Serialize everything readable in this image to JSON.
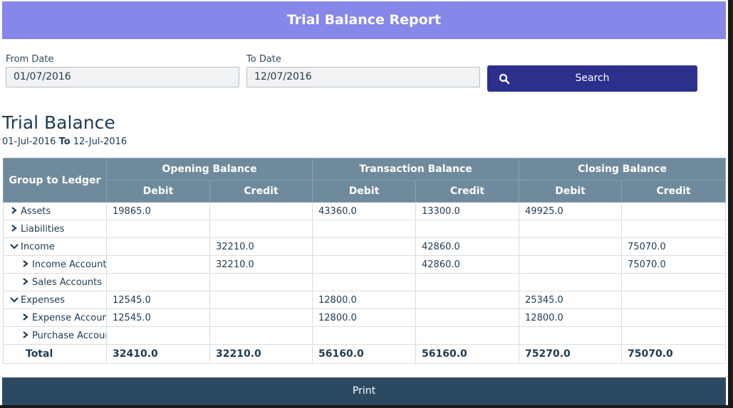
{
  "header": {
    "title": "Trial Balance Report"
  },
  "filters": {
    "from_label": "From Date",
    "from_value": "01/07/2016",
    "to_label": "To Date",
    "to_value": "12/07/2016",
    "search_label": "Search",
    "search_icon": "search-icon"
  },
  "report": {
    "title": "Trial Balance",
    "from": "01-Jul-2016",
    "to_word": "To",
    "to": "12-Jul-2016"
  },
  "table": {
    "group_header": "Group to Ledger",
    "col_groups": [
      "Opening Balance",
      "Transaction Balance",
      "Closing Balance"
    ],
    "sub_headers": [
      "Debit",
      "Credit",
      "Debit",
      "Credit",
      "Debit",
      "Credit"
    ],
    "rows": [
      {
        "label": "Assets",
        "level": 0,
        "expander": "chevron-right",
        "values": [
          "19865.0",
          "",
          "43360.0",
          "13300.0",
          "49925.0",
          ""
        ]
      },
      {
        "label": "Liabilities",
        "level": 0,
        "expander": "chevron-right",
        "values": [
          "",
          "",
          "",
          "",
          "",
          ""
        ]
      },
      {
        "label": "Income",
        "level": 0,
        "expander": "chevron-down",
        "values": [
          "",
          "32210.0",
          "",
          "42860.0",
          "",
          "75070.0"
        ]
      },
      {
        "label": "Income Account",
        "level": 1,
        "expander": "chevron-right",
        "values": [
          "",
          "32210.0",
          "",
          "42860.0",
          "",
          "75070.0"
        ]
      },
      {
        "label": "Sales Accounts",
        "level": 1,
        "expander": "chevron-right",
        "values": [
          "",
          "",
          "",
          "",
          "",
          ""
        ]
      },
      {
        "label": "Expenses",
        "level": 0,
        "expander": "chevron-down",
        "values": [
          "12545.0",
          "",
          "12800.0",
          "",
          "25345.0",
          ""
        ]
      },
      {
        "label": "Expense Account",
        "level": 1,
        "expander": "chevron-right",
        "values": [
          "12545.0",
          "",
          "12800.0",
          "",
          "12800.0",
          ""
        ]
      },
      {
        "label": "Purchase Accounts",
        "level": 1,
        "expander": "chevron-right",
        "values": [
          "",
          "",
          "",
          "",
          "",
          ""
        ]
      }
    ],
    "total": {
      "label": "Total",
      "values": [
        "32410.0",
        "32210.0",
        "56160.0",
        "56160.0",
        "75270.0",
        "75070.0"
      ]
    }
  },
  "footer": {
    "print_label": "Print"
  },
  "colors": {
    "header_bg": "#8687e8",
    "button_bg": "#2d2f8c",
    "table_header_bg": "#6f8a9c",
    "print_bg": "#2b4a62"
  }
}
